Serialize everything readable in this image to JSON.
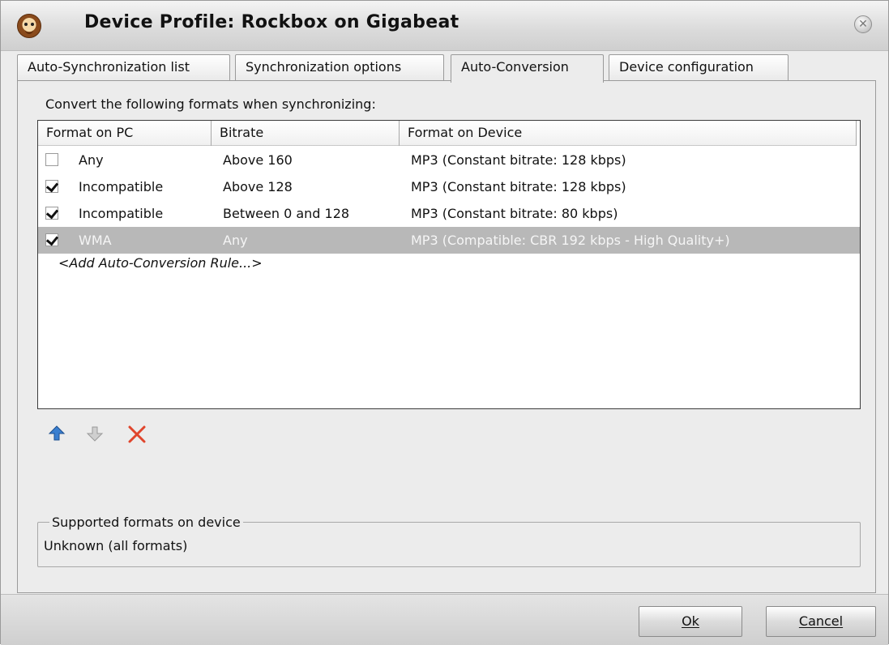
{
  "window": {
    "title": "Device Profile: Rockbox on Gigabeat"
  },
  "tabs": [
    {
      "label": "Auto-Synchronization list"
    },
    {
      "label": "Synchronization options"
    },
    {
      "label": "Auto-Conversion"
    },
    {
      "label": "Device configuration"
    }
  ],
  "active_tab": "Auto-Conversion",
  "prompt": "Convert the following formats when synchronizing:",
  "list": {
    "columns": [
      "Format on PC",
      "Bitrate",
      "Format on Device"
    ],
    "rows": [
      {
        "checked": false,
        "format": "Any",
        "bitrate": "Above 160",
        "device_format": "MP3 (Constant bitrate: 128 kbps)"
      },
      {
        "checked": true,
        "format": "Incompatible",
        "bitrate": "Above 128",
        "device_format": "MP3 (Constant bitrate: 128 kbps)"
      },
      {
        "checked": true,
        "format": "Incompatible",
        "bitrate": "Between 0 and 128",
        "device_format": "MP3 (Constant bitrate: 80 kbps)"
      },
      {
        "checked": true,
        "format": "WMA",
        "bitrate": "Any",
        "device_format": "MP3 (Compatible: CBR 192 kbps - High Quality+)",
        "selected": true
      }
    ],
    "add_rule": "<Add Auto-Conversion Rule...>"
  },
  "toolbar": {
    "move_up_icon": "arrow-up-icon",
    "move_down_icon": "arrow-down-icon",
    "delete_icon": "delete-x-icon",
    "accent": "#3a7fd0",
    "delete_color": "#e0452c"
  },
  "supported": {
    "label": "Supported formats on device",
    "value": "Unknown (all formats)"
  },
  "buttons": {
    "ok": "Ok",
    "cancel": "Cancel"
  }
}
